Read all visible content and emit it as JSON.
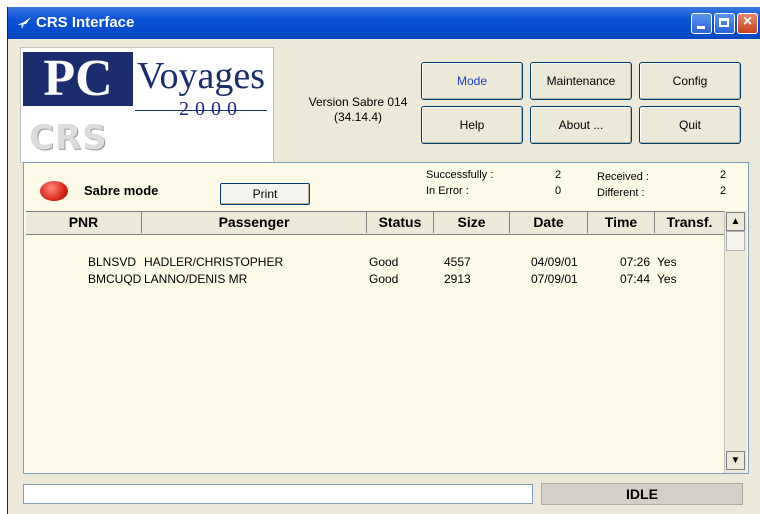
{
  "window": {
    "title": "CRS Interface",
    "close_glyph": "×"
  },
  "logo": {
    "pc": "PC",
    "voyages": "Voyages",
    "year": "2000",
    "crs": "CRS interface"
  },
  "version": {
    "line1": "Version Sabre 014",
    "line2": "(34.14.4)"
  },
  "buttons": {
    "mode": "Mode",
    "maintenance": "Maintenance",
    "config": "Config",
    "help": "Help",
    "about": "About ...",
    "quit": "Quit"
  },
  "mode_panel": {
    "icon": "red-oval-icon",
    "label": "Sabre mode",
    "print": "Print"
  },
  "stats": {
    "successfully_label": "Successfully :",
    "successfully_value": "2",
    "in_error_label": "In Error :",
    "in_error_value": "0",
    "received_label": "Received :",
    "received_value": "2",
    "different_label": "Different :",
    "different_value": "2"
  },
  "table": {
    "columns": [
      "PNR",
      "Passenger",
      "Status",
      "Size",
      "Date",
      "Time",
      "Transf."
    ],
    "rows": [
      {
        "pnr": "BLNSVD",
        "passenger": "HADLER/CHRISTOPHER",
        "status": "Good",
        "size": "4557",
        "date": "04/09/01",
        "time": "07:26",
        "transf": "Yes"
      },
      {
        "pnr": "BMCUQD",
        "passenger": "LANNO/DENIS MR",
        "status": "Good",
        "size": "2913",
        "date": "07/09/01",
        "time": "07:44",
        "transf": "Yes"
      }
    ]
  },
  "statusbar": {
    "input_value": "",
    "state": "IDLE"
  },
  "colors": {
    "titlebar": "#0a52d8",
    "panel_bg": "#fbfbe8",
    "logo_navy": "#1b2d6e"
  }
}
